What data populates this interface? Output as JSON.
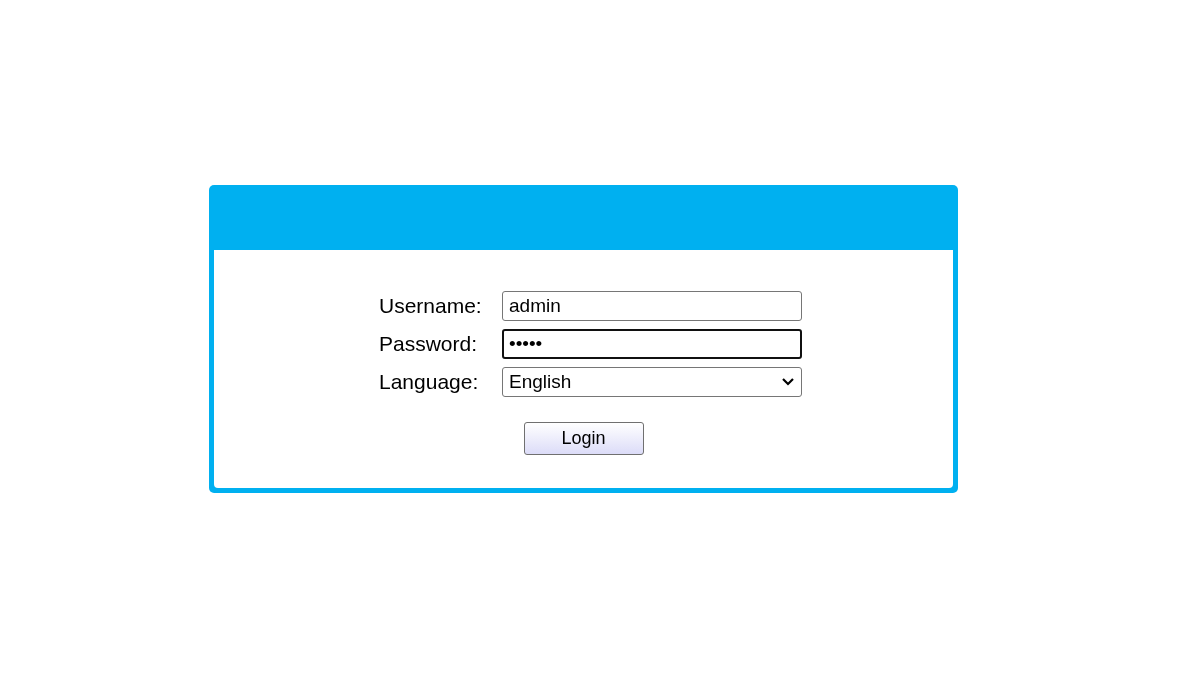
{
  "login_form": {
    "fields": [
      {
        "kind": "text",
        "label": "Username:",
        "value": "admin",
        "focused": false
      },
      {
        "kind": "password",
        "label": "Password:",
        "value": "•••••",
        "focused": true
      },
      {
        "kind": "select",
        "label": "Language:",
        "value": "English",
        "focused": false
      }
    ],
    "button": "Login"
  }
}
